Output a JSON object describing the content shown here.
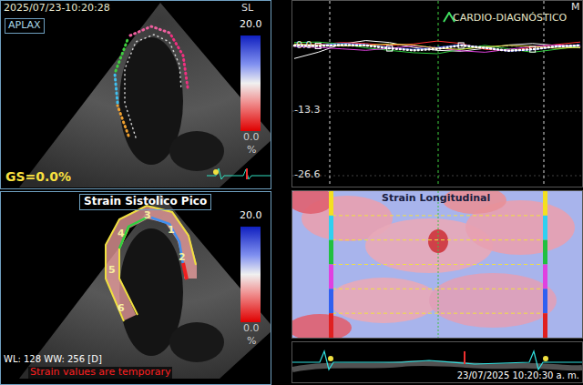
{
  "top_panel": {
    "datetime": "2025/07/23-10:20:28",
    "view": "APLAX",
    "scale_label": "SL",
    "scale_max": "20.0",
    "scale_min": "0.0",
    "scale_unit": "%",
    "global_strain": "GS=0.0%"
  },
  "bottom_panel": {
    "title": "Strain Sistolico Pico",
    "scale_max": "20.0",
    "scale_min": "0.0",
    "scale_unit": "%",
    "segment_labels": [
      "1",
      "2",
      "3",
      "4",
      "5",
      "6"
    ],
    "window_level": "WL: 128 WW: 256 [D]",
    "warning": "Strain values are temporary"
  },
  "chart": {
    "corner": "M",
    "brand": "CARDIO-DIAGNÓSTICO",
    "y_ticks": [
      "0.0",
      "-13.3",
      "-26.6"
    ],
    "series": [
      {
        "color": "#ffffff",
        "dotted": false,
        "values": [
          -2.5,
          -1.2,
          0.5,
          1.2,
          0.8,
          -0.2,
          -0.8,
          -1.0,
          -0.4,
          0.3,
          0.6,
          0.2,
          -0.3
        ]
      },
      {
        "color": "#ff3030",
        "dotted": false,
        "values": [
          0.2,
          0.4,
          0.8,
          0.6,
          0.2,
          0.5,
          1.1,
          0.6,
          -0.6,
          -0.9,
          -0.2,
          0.4,
          0.9
        ]
      },
      {
        "color": "#30d040",
        "dotted": false,
        "values": [
          0.8,
          0.9,
          0.5,
          -0.3,
          -0.8,
          -1.3,
          -1.5,
          -0.6,
          0.2,
          -0.5,
          -1.2,
          -0.6,
          0.1
        ]
      },
      {
        "color": "#4060ff",
        "dotted": false,
        "values": [
          0.1,
          0.3,
          0.6,
          0.4,
          -0.2,
          -0.6,
          -0.2,
          0.4,
          -0.3,
          -1.0,
          -0.7,
          -0.1,
          0.4
        ]
      },
      {
        "color": "#e040e0",
        "dotted": false,
        "values": [
          0.0,
          -0.2,
          -0.5,
          -0.8,
          -0.4,
          0.1,
          -0.3,
          -0.9,
          -1.2,
          -0.6,
          0.0,
          0.3,
          0.1
        ]
      },
      {
        "color": "#e8e040",
        "dotted": false,
        "values": [
          0.5,
          0.3,
          0.1,
          0.2,
          0.5,
          0.3,
          -0.4,
          -0.6,
          -0.1,
          0.2,
          0.0,
          -0.4,
          -0.2
        ]
      },
      {
        "color": "#ffffff",
        "dotted": true,
        "values": [
          0.2,
          0.1,
          0.3,
          0.2,
          -0.4,
          -0.8,
          -0.5,
          0.2,
          -0.3,
          -0.9,
          -0.6,
          0.0,
          0.2
        ]
      }
    ]
  },
  "strain_map": {
    "title": "Strain Longitudinal",
    "segments": [
      {
        "color": "#f4e020"
      },
      {
        "color": "#30d0f0"
      },
      {
        "color": "#20c040"
      },
      {
        "color": "#e040e0"
      },
      {
        "color": "#3060f0"
      },
      {
        "color": "#e02020"
      }
    ]
  },
  "strip": {
    "timestamp": "23/07/2025 10:20:30 a. m."
  }
}
